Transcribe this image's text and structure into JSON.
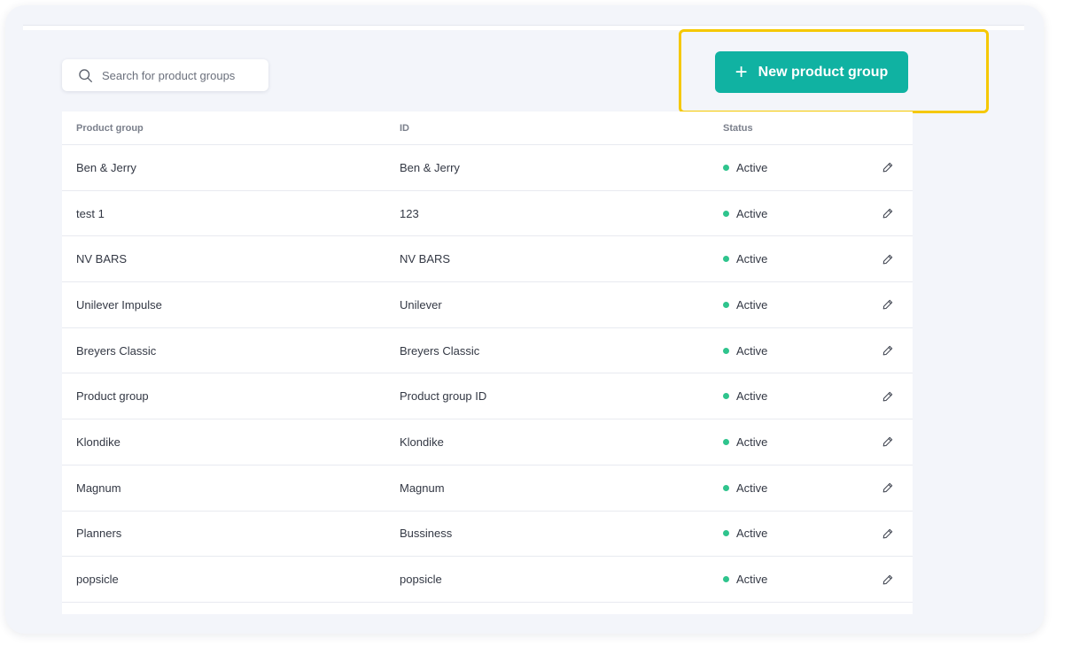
{
  "search": {
    "placeholder": "Search for product groups"
  },
  "new_button": {
    "label": "New product group",
    "icon": "plus-icon"
  },
  "table": {
    "columns": [
      "Product group",
      "ID",
      "Status"
    ],
    "rows": [
      {
        "name": "Ben & Jerry",
        "id": "Ben & Jerry",
        "status": "Active"
      },
      {
        "name": "test 1",
        "id": "123",
        "status": "Active"
      },
      {
        "name": "NV BARS",
        "id": "NV BARS",
        "status": "Active"
      },
      {
        "name": "Unilever Impulse",
        "id": "Unilever",
        "status": "Active"
      },
      {
        "name": "Breyers Classic",
        "id": "Breyers Classic",
        "status": "Active"
      },
      {
        "name": "Product group",
        "id": "Product group ID",
        "status": "Active"
      },
      {
        "name": "Klondike",
        "id": "Klondike",
        "status": "Active"
      },
      {
        "name": "Magnum",
        "id": "Magnum",
        "status": "Active"
      },
      {
        "name": "Planners",
        "id": "Bussiness",
        "status": "Active"
      },
      {
        "name": "popsicle",
        "id": "popsicle",
        "status": "Active"
      }
    ],
    "row_action_icon": "pencil-icon"
  },
  "colors": {
    "accent": "#10b2a2",
    "status_active": "#2fc48d",
    "highlight": "#f5c800",
    "background": "#f3f5fa"
  }
}
